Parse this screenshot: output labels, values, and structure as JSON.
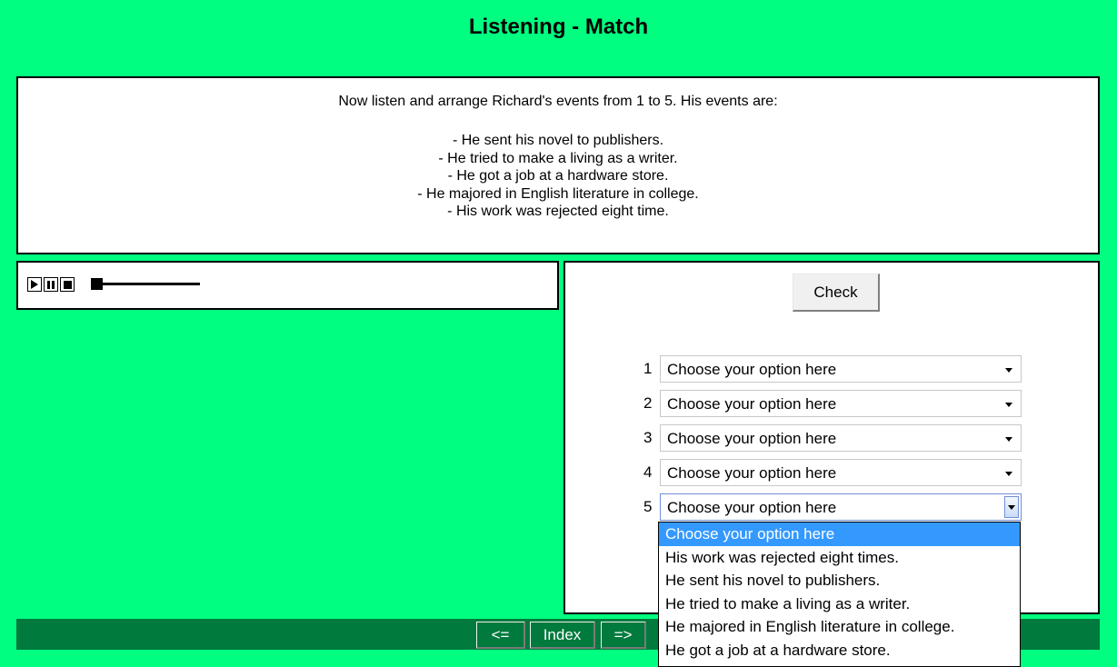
{
  "page": {
    "title": "Listening - Match"
  },
  "instructions": {
    "intro": "Now listen and arrange Richard's events from 1 to 5. His events are:",
    "events": [
      "- He sent his novel to publishers.",
      "- He tried to make a living as a writer.",
      "- He got a job at a hardware store.",
      "- He majored in English literature in college.",
      "- His work was rejected eight time."
    ]
  },
  "player": {
    "controls": [
      "play-icon",
      "pause-icon",
      "stop-icon"
    ],
    "progress": 0
  },
  "answers": {
    "check_label": "Check",
    "rows": [
      {
        "number": "1",
        "value": "Choose your option here"
      },
      {
        "number": "2",
        "value": "Choose your option here"
      },
      {
        "number": "3",
        "value": "Choose your option here"
      },
      {
        "number": "4",
        "value": "Choose your option here"
      },
      {
        "number": "5",
        "value": "Choose your option here"
      }
    ]
  },
  "dropdown": {
    "options": [
      "Choose your option here",
      "His work was rejected eight times.",
      "He sent his novel to publishers.",
      "He tried to make a living as a writer.",
      "He majored in English literature in college.",
      "He got a job at a hardware store."
    ],
    "selected_index": 0
  },
  "footer": {
    "prev_label": "<=",
    "index_label": "Index",
    "next_label": "=>"
  },
  "colors": {
    "background": "#00ff80",
    "footer": "#007a3d",
    "selection": "#3399ff"
  }
}
